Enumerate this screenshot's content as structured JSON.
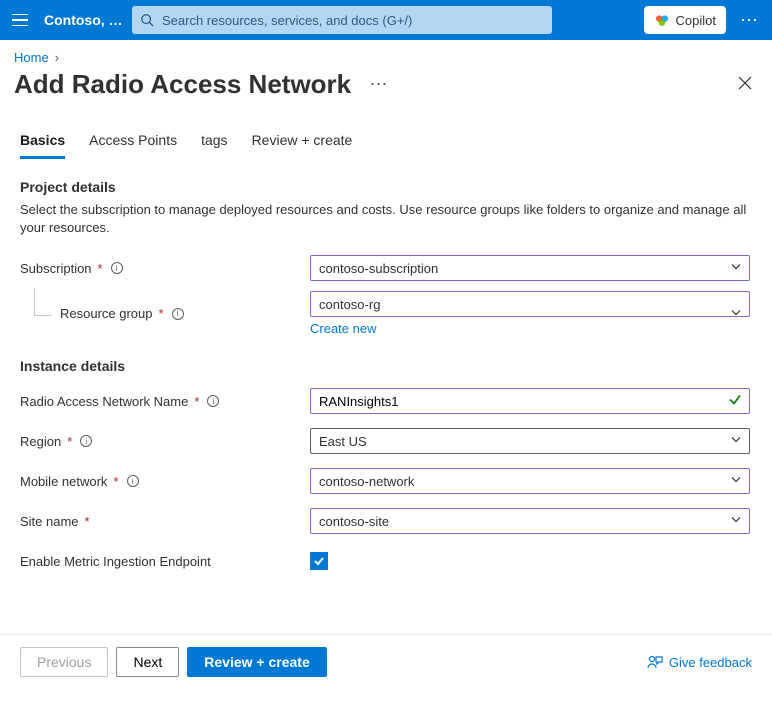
{
  "header": {
    "tenant": "Contoso, L...",
    "search_placeholder": "Search resources, services, and docs (G+/)",
    "copilot_label": "Copilot"
  },
  "breadcrumb": {
    "home": "Home"
  },
  "page": {
    "title": "Add Radio Access Network"
  },
  "tabs": [
    "Basics",
    "Access Points",
    "tags",
    "Review + create"
  ],
  "sections": {
    "project_details": {
      "heading": "Project details",
      "description": "Select the subscription to manage deployed resources and costs. Use resource groups like folders to organize and manage all your resources.",
      "subscription_label": "Subscription",
      "subscription_value": "contoso-subscription",
      "rg_label": "Resource group",
      "rg_value": "contoso-rg",
      "create_new": "Create new"
    },
    "instance_details": {
      "heading": "Instance details",
      "name_label": "Radio Access Network Name",
      "name_value": "RANInsights1",
      "region_label": "Region",
      "region_value": "East US",
      "mobile_label": "Mobile network",
      "mobile_value": "contoso-network",
      "site_label": "Site name",
      "site_value": "contoso-site",
      "metric_label": "Enable Metric Ingestion Endpoint"
    }
  },
  "footer": {
    "previous": "Previous",
    "next": "Next",
    "review": "Review + create",
    "feedback": "Give feedback"
  }
}
